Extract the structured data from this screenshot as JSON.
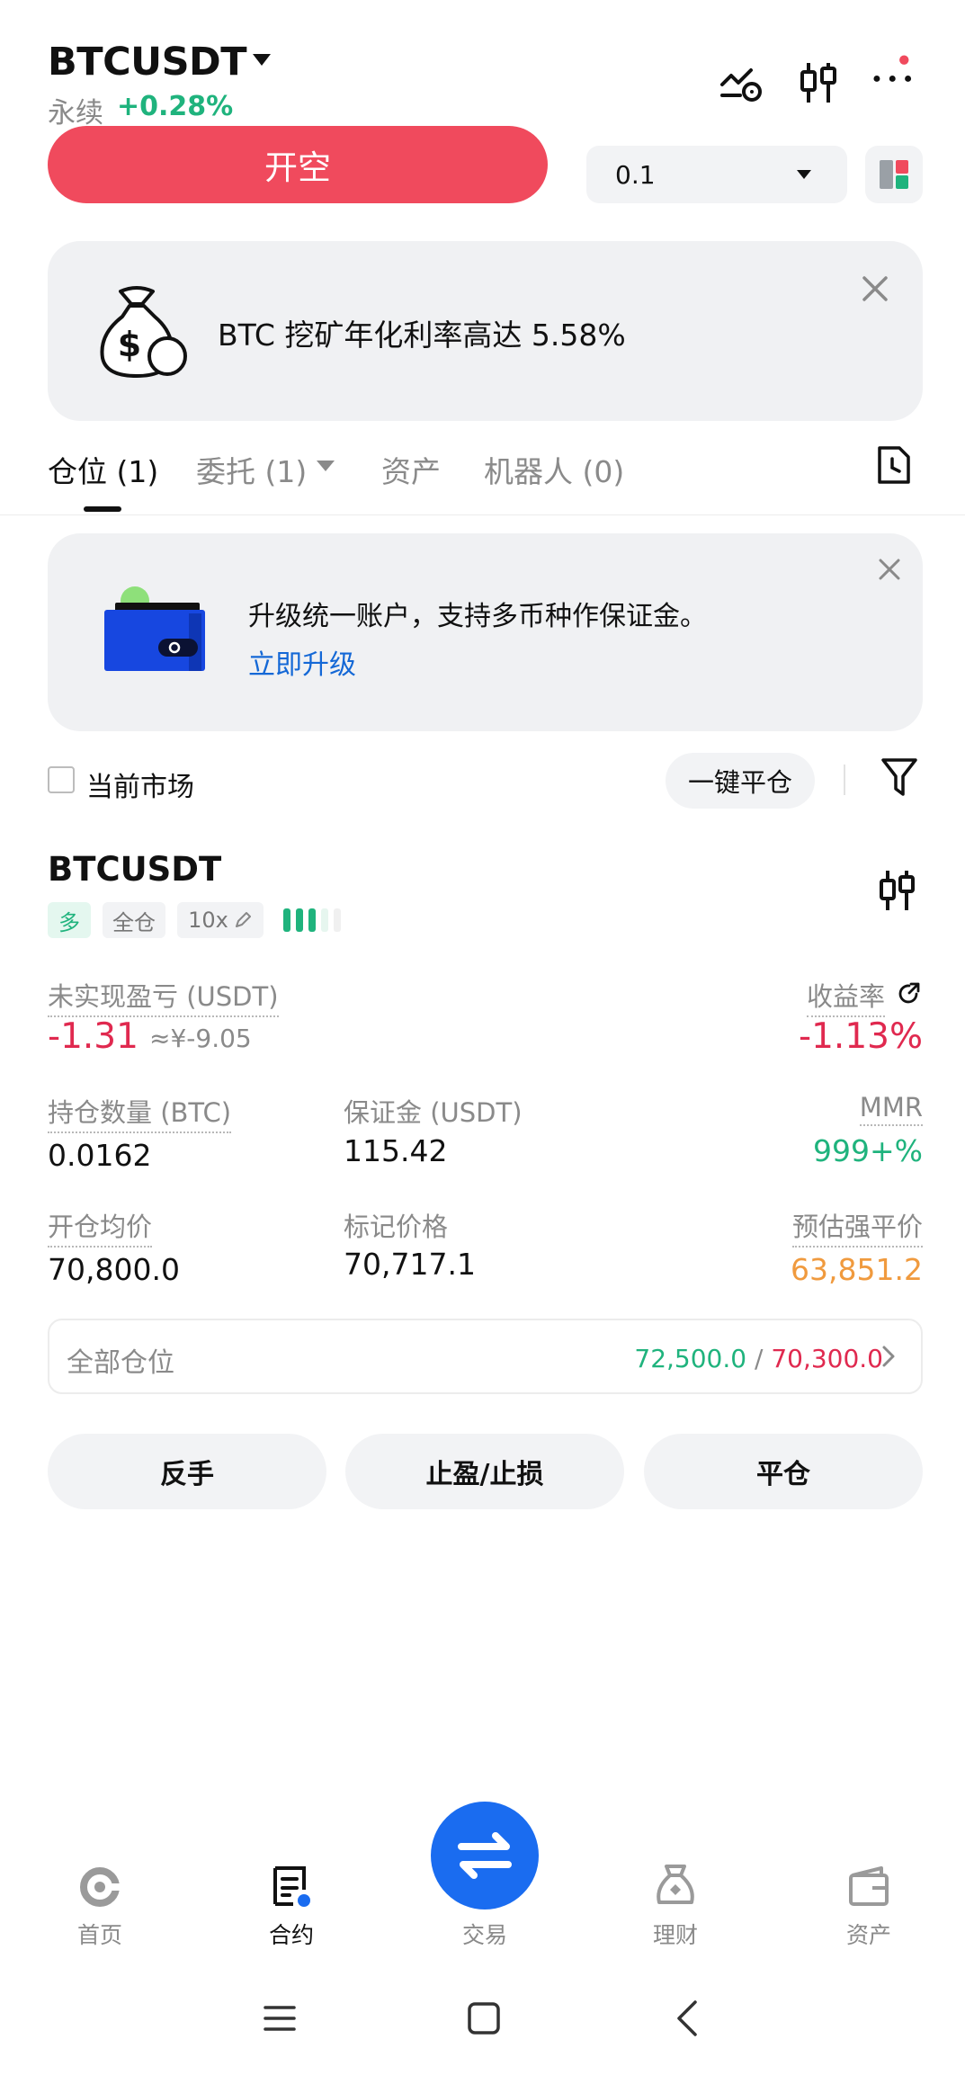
{
  "header": {
    "symbol": "BTCUSDT",
    "contract_type": "永续",
    "change": "+0.28%"
  },
  "order": {
    "sell_label": "开空",
    "quantity": "0.1"
  },
  "promo": {
    "text": "BTC 挖矿年化利率高达 5.58%"
  },
  "tabs": [
    {
      "label": "仓位 (1)"
    },
    {
      "label": "委托 (1)"
    },
    {
      "label": "资产"
    },
    {
      "label": "机器人 (0)"
    }
  ],
  "upgrade": {
    "text": "升级统一账户，支持多币种作保证金。",
    "link": "立即升级"
  },
  "filters": {
    "current_market": "当前市场",
    "close_all": "一键平仓"
  },
  "position": {
    "symbol": "BTCUSDT",
    "side": "多",
    "margin_mode": "全仓",
    "leverage": "10x",
    "risk_level": 3,
    "unrealized_label": "未实现盈亏 (USDT)",
    "unrealized_value": "-1.31",
    "unrealized_cny": "≈¥-9.05",
    "roe_label": "收益率",
    "roe_value": "-1.13%",
    "size_label": "持仓数量 (BTC)",
    "size_value": "0.0162",
    "margin_label": "保证金 (USDT)",
    "margin_value": "115.42",
    "mmr_label": "MMR",
    "mmr_value": "999+%",
    "entry_label": "开仓均价",
    "entry_value": "70,800.0",
    "mark_label": "标记价格",
    "mark_value": "70,717.1",
    "liq_label": "预估强平价",
    "liq_value": "63,851.2",
    "all_positions_label": "全部仓位",
    "tp_value": "72,500.0",
    "separator": "/",
    "sl_value": "70,300.0"
  },
  "actions": {
    "reverse": "反手",
    "tpsl": "止盈/止损",
    "close": "平仓"
  },
  "nav": [
    {
      "label": "首页",
      "icon": "home-icon"
    },
    {
      "label": "合约",
      "icon": "futures-icon"
    },
    {
      "label": "交易",
      "icon": "swap-icon"
    },
    {
      "label": "理财",
      "icon": "earn-icon"
    },
    {
      "label": "资产",
      "icon": "wallet-icon"
    }
  ],
  "colors": {
    "sell": "#f04a5d",
    "profit": "#1fb37d",
    "loss": "#e0294f",
    "liquidation": "#f09a3e",
    "accent": "#1a6cf0",
    "link": "#1468d6"
  }
}
